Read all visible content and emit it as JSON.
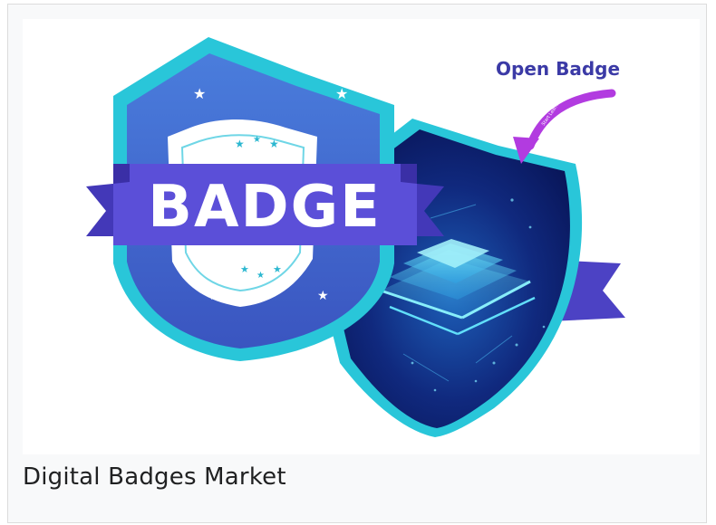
{
  "image": {
    "open_badge_label": "Open Badge",
    "arrow_label": "Start Learning",
    "badge_word": "BADGE",
    "colors": {
      "cyan_rim": "#29c6d9",
      "badge_blue": "#3f63c8",
      "ribbon_purple": "#5b4fd8",
      "ribbon_dark": "#4338b8",
      "dark_shield": "#0d1a6b",
      "magenta_arrow": "#b23be0"
    }
  },
  "caption": "Digital Badges Market"
}
